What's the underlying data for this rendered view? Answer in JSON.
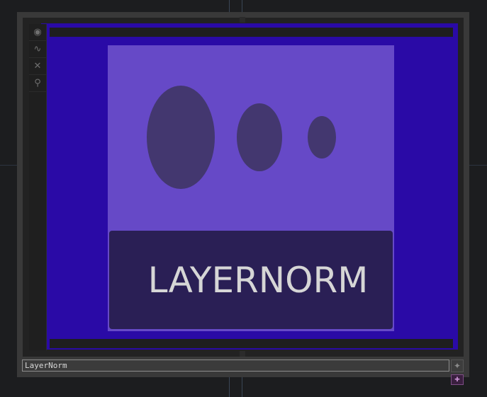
{
  "node": {
    "name": "LayerNorm",
    "banner_text": "LAYERNORM"
  },
  "toolbar": {
    "items": [
      {
        "icon": "viewer-icon",
        "glyph": "◉"
      },
      {
        "icon": "graph-icon",
        "glyph": "∿"
      },
      {
        "icon": "close-icon",
        "glyph": "✕"
      },
      {
        "icon": "link-icon",
        "glyph": "⚲"
      }
    ]
  },
  "colors": {
    "node_frame": "#2a0aa6",
    "viewer_bg": "#6649c7",
    "ellipse": "#43376f",
    "banner_bg": "#2a1f55",
    "banner_text": "#d6d6d6"
  }
}
